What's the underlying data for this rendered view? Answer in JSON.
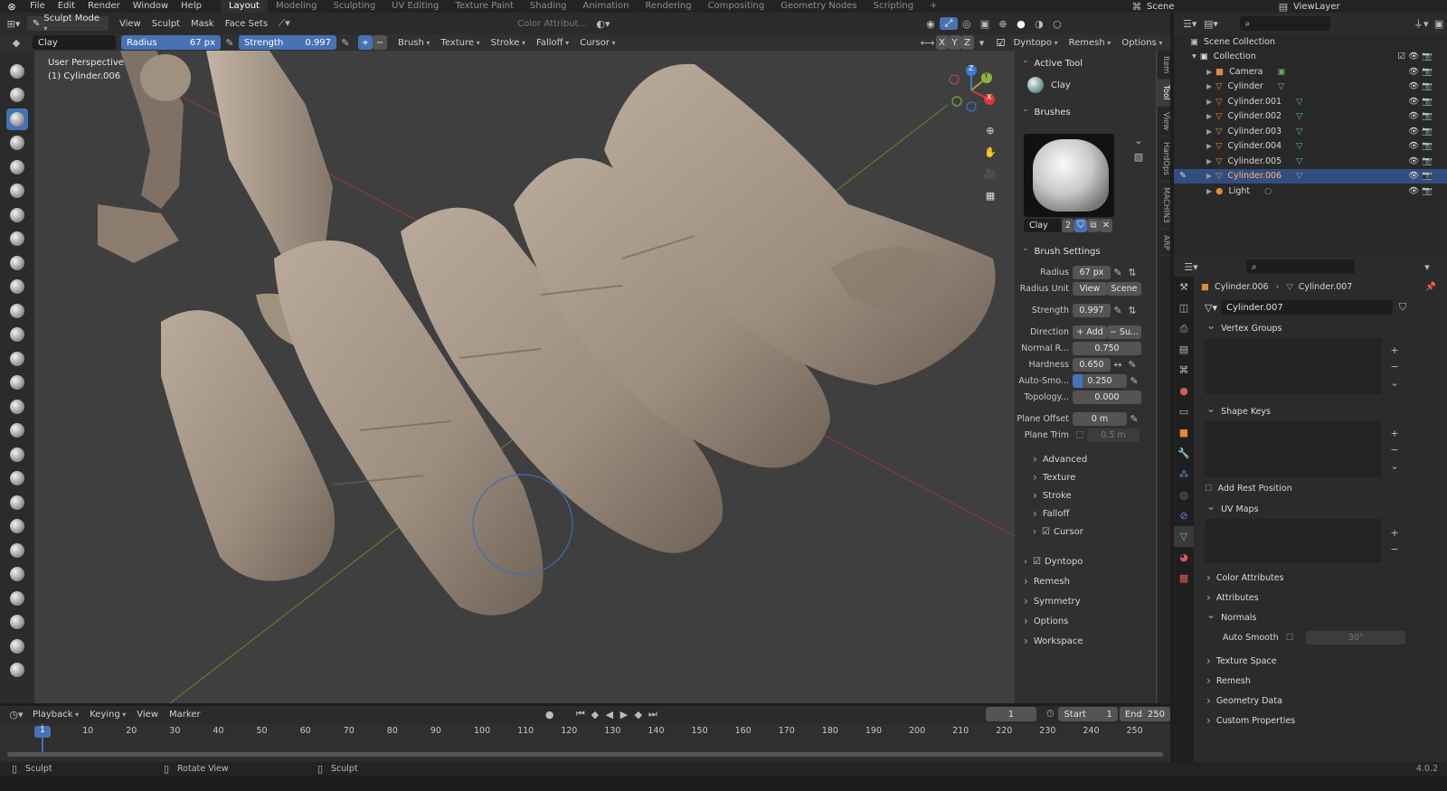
{
  "topbar": {
    "menus": [
      "File",
      "Edit",
      "Render",
      "Window",
      "Help"
    ],
    "workspaces": [
      "Layout",
      "Modeling",
      "Sculpting",
      "UV Editing",
      "Texture Paint",
      "Shading",
      "Animation",
      "Rendering",
      "Compositing",
      "Geometry Nodes",
      "Scripting"
    ],
    "active_workspace": "Layout",
    "scene": "Scene",
    "view_layer": "ViewLayer"
  },
  "viewport_header": {
    "mode": "Sculpt Mode",
    "menus": [
      "View",
      "Sculpt",
      "Mask",
      "Face Sets"
    ],
    "color_attribute": "Color Attribut..."
  },
  "tool_header": {
    "brush_name": "Clay",
    "radius_label": "Radius",
    "radius_value": "67 px",
    "strength_label": "Strength",
    "strength_value": "0.997",
    "plus": "+",
    "minus": "−",
    "dropdowns": [
      "Brush",
      "Texture",
      "Stroke",
      "Falloff",
      "Cursor"
    ],
    "axes": [
      "X",
      "Y",
      "Z"
    ],
    "dyntopo": "Dyntopo",
    "remesh": "Remesh",
    "options": "Options"
  },
  "viewport": {
    "perspective": "User Perspective",
    "object": "(1) Cylinder.006",
    "gizmo": {
      "x": "X",
      "y": "Y",
      "z": "Z"
    }
  },
  "npanel": {
    "active_tool_title": "Active Tool",
    "active_tool_name": "Clay",
    "brushes_title": "Brushes",
    "brush_name": "Clay",
    "brush_users": "2",
    "brush_settings_title": "Brush Settings",
    "radius_label": "Radius",
    "radius_value": "67 px",
    "radius_unit_label": "Radius Unit",
    "radius_unit_view": "View",
    "radius_unit_scene": "Scene",
    "strength_label": "Strength",
    "strength_value": "0.997",
    "direction_label": "Direction",
    "direction_add": "+ Add",
    "direction_sub": "− Su...",
    "normal_radius_label": "Normal R...",
    "normal_radius_value": "0.750",
    "hardness_label": "Hardness",
    "hardness_value": "0.650",
    "autosmooth_label": "Auto-Smo...",
    "autosmooth_value": "0.250",
    "topology_label": "Topology...",
    "topology_value": "0.000",
    "plane_offset_label": "Plane Offset",
    "plane_offset_value": "0 m",
    "plane_trim_label": "Plane Trim",
    "plane_trim_value": "0.5 m",
    "subpanels": [
      "Advanced",
      "Texture",
      "Stroke",
      "Falloff",
      "Cursor"
    ],
    "panels": [
      "Dyntopo",
      "Remesh",
      "Symmetry",
      "Options",
      "Workspace"
    ],
    "tabs": [
      "Item",
      "Tool",
      "View",
      "HardOps",
      "MACHIN3",
      "ARP"
    ]
  },
  "outliner": {
    "scene_collection": "Scene Collection",
    "collection": "Collection",
    "items": [
      "Camera",
      "Cylinder",
      "Cylinder.001",
      "Cylinder.002",
      "Cylinder.003",
      "Cylinder.004",
      "Cylinder.005",
      "Cylinder.006",
      "Light"
    ],
    "selected": "Cylinder.006"
  },
  "properties": {
    "breadcrumb_object": "Cylinder.006",
    "breadcrumb_data": "Cylinder.007",
    "mesh_name": "Cylinder.007",
    "sections": {
      "vertex_groups": "Vertex Groups",
      "shape_keys": "Shape Keys",
      "add_rest_position": "Add Rest Position",
      "uv_maps": "UV Maps",
      "color_attributes": "Color Attributes",
      "attributes": "Attributes",
      "normals": "Normals",
      "auto_smooth": "Auto Smooth",
      "auto_smooth_angle": "30°",
      "texture_space": "Texture Space",
      "remesh": "Remesh",
      "geometry_data": "Geometry Data",
      "custom_properties": "Custom Properties"
    }
  },
  "timeline": {
    "menus": [
      "Playback",
      "Keying",
      "View",
      "Marker"
    ],
    "current_frame": "1",
    "start_label": "Start",
    "start_value": "1",
    "end_label": "End",
    "end_value": "250",
    "ticks": [
      "1",
      "10",
      "20",
      "30",
      "40",
      "50",
      "60",
      "70",
      "80",
      "90",
      "100",
      "110",
      "120",
      "130",
      "140",
      "150",
      "160",
      "170",
      "180",
      "190",
      "200",
      "210",
      "220",
      "230",
      "240",
      "250"
    ]
  },
  "statusbar": {
    "left": "Sculpt",
    "middle": "Rotate View",
    "right": "Sculpt",
    "version": "4.0.2"
  },
  "colors": {
    "accent": "#4772b3",
    "viewport_bg": "#3f3f3f",
    "mesh": "#a8998a"
  }
}
